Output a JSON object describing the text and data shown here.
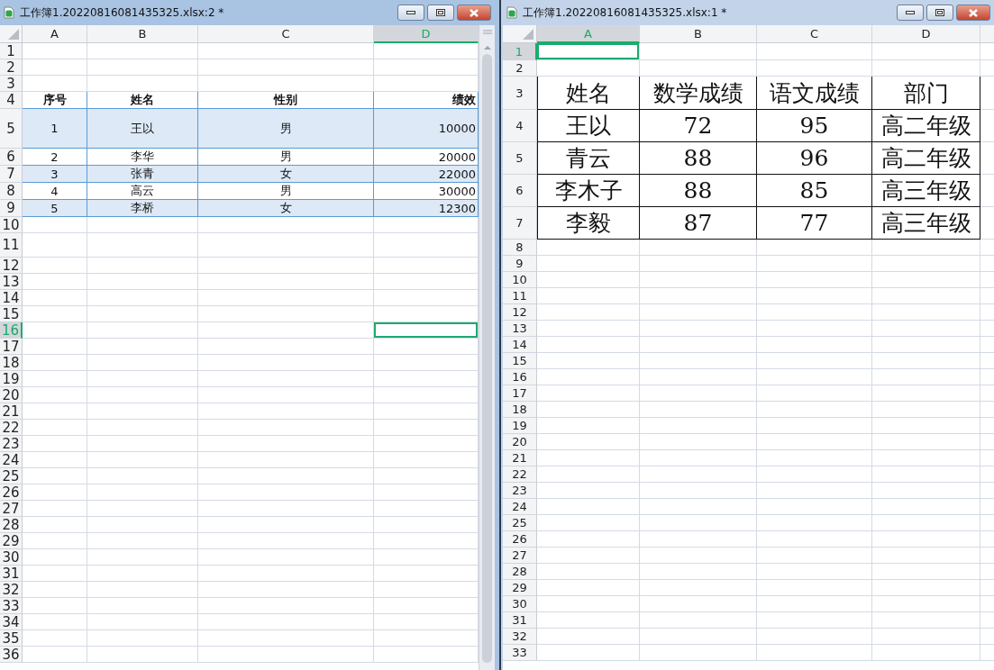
{
  "windows": [
    {
      "title": "工作簿1.20220816081435325.xlsx:2 *",
      "columns": [
        {
          "label": "A",
          "selected": false
        },
        {
          "label": "B",
          "selected": false
        },
        {
          "label": "C",
          "selected": false
        },
        {
          "label": "D",
          "selected": true
        }
      ],
      "rows": [
        {
          "label": "1",
          "selected": false,
          "kind": "empty"
        },
        {
          "label": "2",
          "selected": false,
          "kind": "empty"
        },
        {
          "label": "3",
          "selected": false,
          "kind": "empty"
        },
        {
          "label": "4",
          "selected": false,
          "kind": "header",
          "cells": [
            "序号",
            "姓名",
            "性别",
            "绩效"
          ]
        },
        {
          "label": "5",
          "selected": false,
          "kind": "band",
          "cells": [
            "1",
            "王以",
            "男",
            "10000"
          ]
        },
        {
          "label": "6",
          "selected": false,
          "kind": "plain",
          "cells": [
            "2",
            "李华",
            "男",
            "20000"
          ]
        },
        {
          "label": "7",
          "selected": false,
          "kind": "band",
          "cells": [
            "3",
            "张青",
            "女",
            "22000"
          ]
        },
        {
          "label": "8",
          "selected": false,
          "kind": "plain",
          "cells": [
            "4",
            "高云",
            "男",
            "30000"
          ]
        },
        {
          "label": "9",
          "selected": false,
          "kind": "band",
          "cells": [
            "5",
            "李桥",
            "女",
            "12300"
          ]
        },
        {
          "label": "10",
          "selected": false,
          "kind": "empty"
        },
        {
          "label": "11",
          "selected": false,
          "kind": "empty"
        },
        {
          "label": "12",
          "selected": false,
          "kind": "empty"
        },
        {
          "label": "13",
          "selected": false,
          "kind": "empty"
        },
        {
          "label": "14",
          "selected": false,
          "kind": "empty"
        },
        {
          "label": "15",
          "selected": false,
          "kind": "empty"
        },
        {
          "label": "16",
          "selected": true,
          "kind": "empty"
        },
        {
          "label": "17",
          "selected": false,
          "kind": "empty"
        },
        {
          "label": "18",
          "selected": false,
          "kind": "empty"
        },
        {
          "label": "19",
          "selected": false,
          "kind": "empty"
        },
        {
          "label": "20",
          "selected": false,
          "kind": "empty"
        },
        {
          "label": "21",
          "selected": false,
          "kind": "empty"
        },
        {
          "label": "22",
          "selected": false,
          "kind": "empty"
        },
        {
          "label": "23",
          "selected": false,
          "kind": "empty"
        },
        {
          "label": "24",
          "selected": false,
          "kind": "empty"
        },
        {
          "label": "25",
          "selected": false,
          "kind": "empty"
        },
        {
          "label": "26",
          "selected": false,
          "kind": "empty"
        },
        {
          "label": "27",
          "selected": false,
          "kind": "empty"
        },
        {
          "label": "28",
          "selected": false,
          "kind": "empty"
        },
        {
          "label": "29",
          "selected": false,
          "kind": "empty"
        },
        {
          "label": "30",
          "selected": false,
          "kind": "empty"
        },
        {
          "label": "31",
          "selected": false,
          "kind": "empty"
        },
        {
          "label": "32",
          "selected": false,
          "kind": "empty"
        },
        {
          "label": "33",
          "selected": false,
          "kind": "empty"
        },
        {
          "label": "34",
          "selected": false,
          "kind": "empty"
        },
        {
          "label": "35",
          "selected": false,
          "kind": "empty"
        },
        {
          "label": "36",
          "selected": false,
          "kind": "empty"
        }
      ]
    },
    {
      "title": "工作簿1.20220816081435325.xlsx:1 *",
      "columns": [
        {
          "label": "A",
          "selected": true
        },
        {
          "label": "B",
          "selected": false
        },
        {
          "label": "C",
          "selected": false
        },
        {
          "label": "D",
          "selected": false
        }
      ],
      "rows": [
        {
          "label": "1",
          "selected": true,
          "kind": "empty"
        },
        {
          "label": "2",
          "selected": false,
          "kind": "empty"
        },
        {
          "label": "3",
          "selected": false,
          "kind": "boxed",
          "cells": [
            "姓名",
            "数学成绩",
            "语文成绩",
            "部门"
          ]
        },
        {
          "label": "4",
          "selected": false,
          "kind": "boxed",
          "cells": [
            "王以",
            "72",
            "95",
            "高二年级"
          ]
        },
        {
          "label": "5",
          "selected": false,
          "kind": "boxed",
          "cells": [
            "青云",
            "88",
            "96",
            "高二年级"
          ]
        },
        {
          "label": "6",
          "selected": false,
          "kind": "boxed",
          "cells": [
            "李木子",
            "88",
            "85",
            "高三年级"
          ]
        },
        {
          "label": "7",
          "selected": false,
          "kind": "boxed",
          "cells": [
            "李毅",
            "87",
            "77",
            "高三年级"
          ]
        },
        {
          "label": "8",
          "selected": false,
          "kind": "empty"
        },
        {
          "label": "9",
          "selected": false,
          "kind": "empty"
        },
        {
          "label": "10",
          "selected": false,
          "kind": "empty"
        },
        {
          "label": "11",
          "selected": false,
          "kind": "empty"
        },
        {
          "label": "12",
          "selected": false,
          "kind": "empty"
        },
        {
          "label": "13",
          "selected": false,
          "kind": "empty"
        },
        {
          "label": "14",
          "selected": false,
          "kind": "empty"
        },
        {
          "label": "15",
          "selected": false,
          "kind": "empty"
        },
        {
          "label": "16",
          "selected": false,
          "kind": "empty"
        },
        {
          "label": "17",
          "selected": false,
          "kind": "empty"
        },
        {
          "label": "18",
          "selected": false,
          "kind": "empty"
        },
        {
          "label": "19",
          "selected": false,
          "kind": "empty"
        },
        {
          "label": "20",
          "selected": false,
          "kind": "empty"
        },
        {
          "label": "21",
          "selected": false,
          "kind": "empty"
        },
        {
          "label": "22",
          "selected": false,
          "kind": "empty"
        },
        {
          "label": "23",
          "selected": false,
          "kind": "empty"
        },
        {
          "label": "24",
          "selected": false,
          "kind": "empty"
        },
        {
          "label": "25",
          "selected": false,
          "kind": "empty"
        },
        {
          "label": "26",
          "selected": false,
          "kind": "empty"
        },
        {
          "label": "27",
          "selected": false,
          "kind": "empty"
        },
        {
          "label": "28",
          "selected": false,
          "kind": "empty"
        },
        {
          "label": "29",
          "selected": false,
          "kind": "empty"
        },
        {
          "label": "30",
          "selected": false,
          "kind": "empty"
        },
        {
          "label": "31",
          "selected": false,
          "kind": "empty"
        },
        {
          "label": "32",
          "selected": false,
          "kind": "empty"
        },
        {
          "label": "33",
          "selected": false,
          "kind": "empty"
        }
      ]
    }
  ]
}
